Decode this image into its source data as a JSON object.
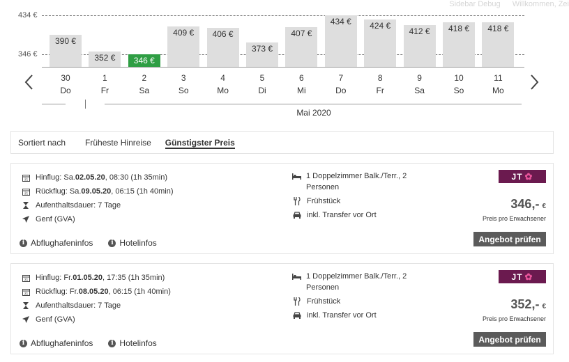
{
  "topbar": {
    "debug": "Sidebar Debug",
    "welcome": "Willkommen, Zei"
  },
  "chart_data": {
    "type": "bar",
    "ref_labels": [
      "434 €",
      "346 €"
    ],
    "ref_values": [
      434,
      346
    ],
    "ylim": [
      330,
      434
    ],
    "selected_index": 2,
    "bars": [
      {
        "day": "30",
        "weekday": "Do",
        "value": 390,
        "label": "390 €"
      },
      {
        "day": "1",
        "weekday": "Fr",
        "value": 352,
        "label": "352 €"
      },
      {
        "day": "2",
        "weekday": "Sa",
        "value": 346,
        "label": "346 €"
      },
      {
        "day": "3",
        "weekday": "So",
        "value": 409,
        "label": "409 €"
      },
      {
        "day": "4",
        "weekday": "Mo",
        "value": 406,
        "label": "406 €"
      },
      {
        "day": "5",
        "weekday": "Di",
        "value": 373,
        "label": "373 €"
      },
      {
        "day": "6",
        "weekday": "Mi",
        "value": 407,
        "label": "407 €"
      },
      {
        "day": "7",
        "weekday": "Do",
        "value": 434,
        "label": "434 €"
      },
      {
        "day": "8",
        "weekday": "Fr",
        "value": 424,
        "label": "424 €"
      },
      {
        "day": "9",
        "weekday": "Sa",
        "value": 412,
        "label": "412 €"
      },
      {
        "day": "10",
        "weekday": "So",
        "value": 418,
        "label": "418 €"
      },
      {
        "day": "11",
        "weekday": "Mo",
        "value": 418,
        "label": "418 €"
      }
    ],
    "month_label": "Mai 2020",
    "colors": {
      "bar": "#dedede",
      "selected": "#2f9e44"
    }
  },
  "sort": {
    "label": "Sortiert nach",
    "options": [
      "Früheste Hinreise",
      "Günstigster Preis"
    ],
    "active_index": 1
  },
  "offers": [
    {
      "outbound_prefix": "Hinflug: Sa. ",
      "outbound_date": "02.05.20",
      "outbound_suffix": ", 08:30 (1h 35min)",
      "return_prefix": "Rückflug: Sa. ",
      "return_date": "09.05.20",
      "return_suffix": ", 06:15 (1h 40min)",
      "duration": "Aufenthaltsdauer: 7 Tage",
      "airport": "Genf (GVA)",
      "room": "1 Doppelzimmer Balk./Terr., 2 Personen",
      "board": "Frühstück",
      "transfer": "inkl. Transfer vor Ort",
      "operator": "JT",
      "price": "346,-",
      "currency": "€",
      "per_person": "Preis pro Erwachsener",
      "cta": "Angebot prüfen",
      "link_airport": "Abflughafeninfos",
      "link_hotel": "Hotelinfos"
    },
    {
      "outbound_prefix": "Hinflug: Fr. ",
      "outbound_date": "01.05.20",
      "outbound_suffix": ", 17:35 (1h 35min)",
      "return_prefix": "Rückflug: Fr. ",
      "return_date": "08.05.20",
      "return_suffix": ", 06:15 (1h 40min)",
      "duration": "Aufenthaltsdauer: 7 Tage",
      "airport": "Genf (GVA)",
      "room": "1 Doppelzimmer Balk./Terr., 2 Personen",
      "board": "Frühstück",
      "transfer": "inkl. Transfer vor Ort",
      "operator": "JT",
      "price": "352,-",
      "currency": "€",
      "per_person": "Preis pro Erwachsener",
      "cta": "Angebot prüfen",
      "link_airport": "Abflughafeninfos",
      "link_hotel": "Hotelinfos"
    }
  ],
  "icons": {
    "calendar": "calendar-icon",
    "hourglass": "hourglass-icon",
    "plane": "plane-icon",
    "bed": "bed-icon",
    "cutlery": "cutlery-icon",
    "car": "car-icon",
    "info": "info-icon",
    "prev": "chevron-left-icon",
    "next": "chevron-right-icon"
  }
}
